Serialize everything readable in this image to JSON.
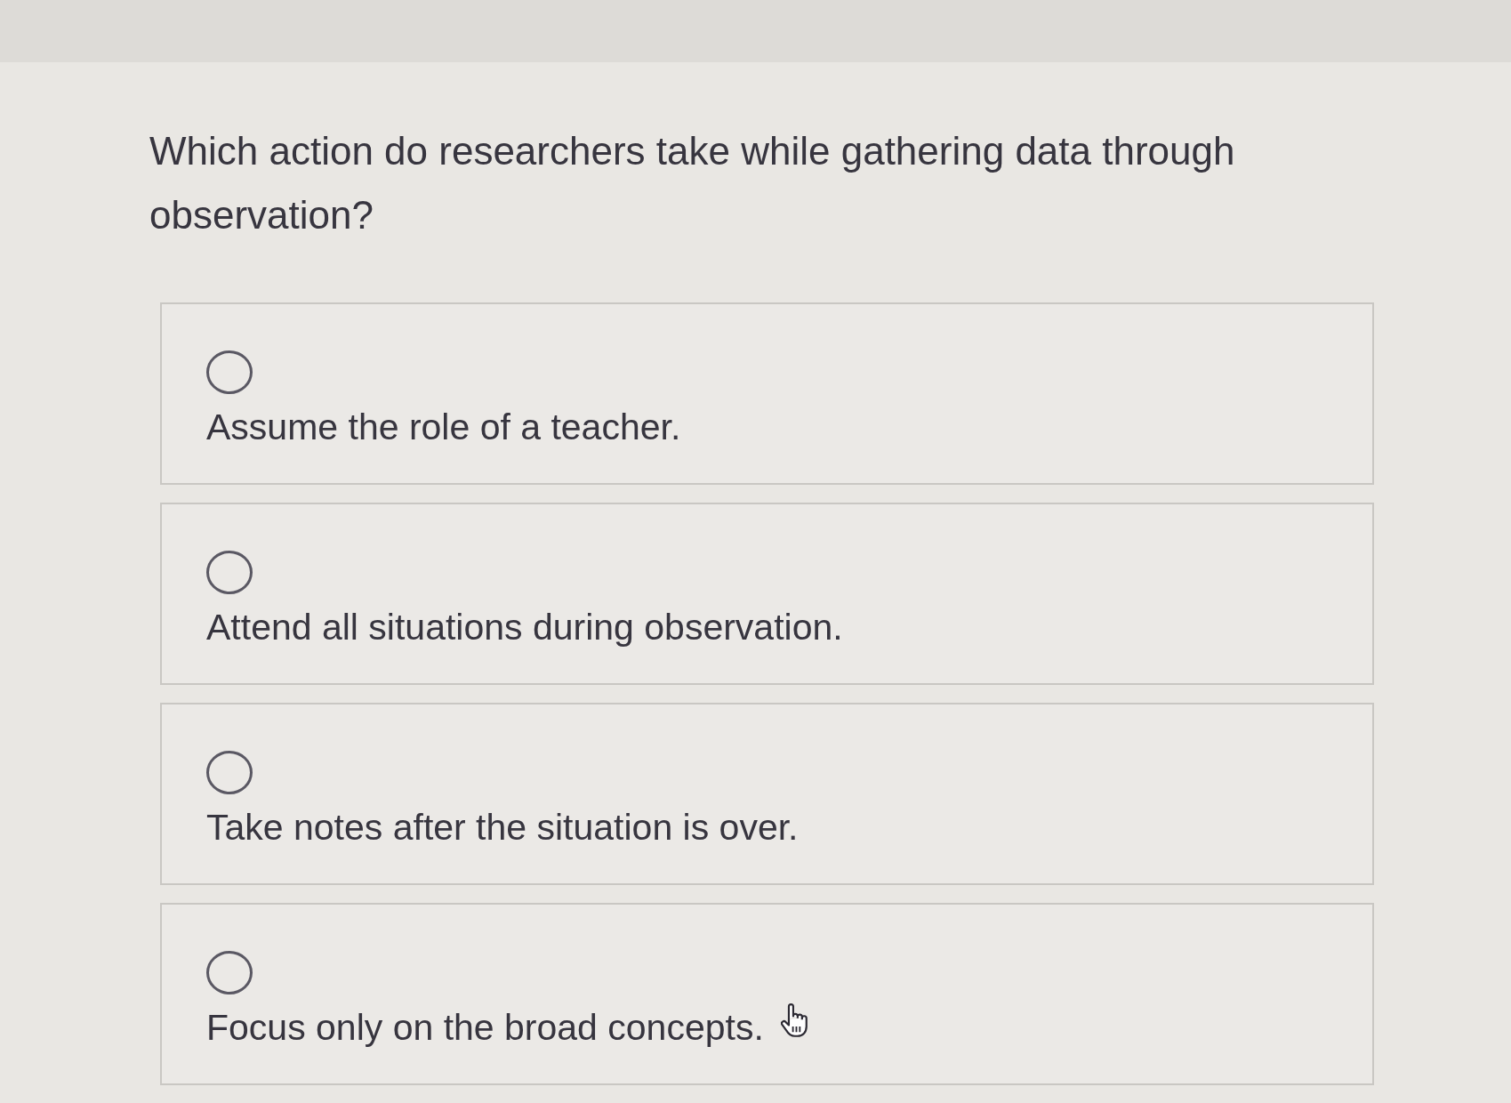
{
  "question": "Which action do researchers take while gathering data through observation?",
  "options": [
    {
      "label": "Assume the role of a teacher.",
      "selected": false
    },
    {
      "label": "Attend all situations during observation.",
      "selected": false
    },
    {
      "label": "Take notes after the situation is over.",
      "selected": false
    },
    {
      "label": "Focus only on the broad concepts.",
      "selected": false
    }
  ]
}
